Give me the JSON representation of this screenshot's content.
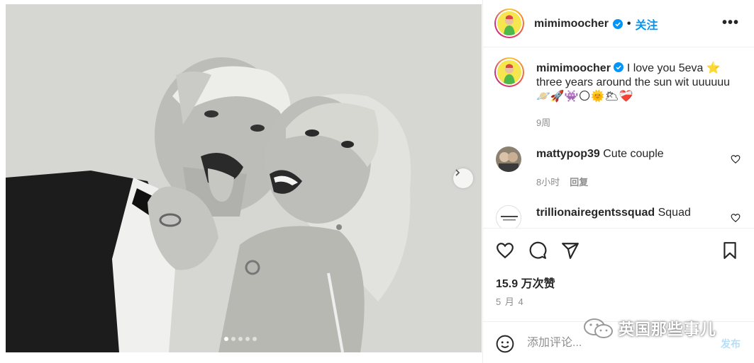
{
  "post": {
    "username": "mimimoocher",
    "follow_label": "关注",
    "separator": "•",
    "more_label": "•••",
    "caption_text": "I love you 5eva ⭐ three years around the sun wit uuuuuu🪐🚀👾🌕🌞🌥❤️‍🩹",
    "caption_time": "9周"
  },
  "photo": {
    "dots_total": 5,
    "active_dot": 1
  },
  "comments": [
    {
      "username": "mattypop39",
      "text": "Cute couple",
      "time": "8小时",
      "reply_label": "回复"
    },
    {
      "username": "trillionairegentssquad",
      "text": "Squad"
    }
  ],
  "actions": {
    "likes": "15.9 万次赞",
    "date": "5 月 4"
  },
  "add_comment": {
    "placeholder": "添加评论...",
    "post_label": "发布"
  },
  "watermark": {
    "text": "英国那些事儿"
  },
  "colors": {
    "accent": "#0095f6",
    "text": "#262626",
    "muted": "#8e8e8e",
    "border": "#efefef"
  }
}
